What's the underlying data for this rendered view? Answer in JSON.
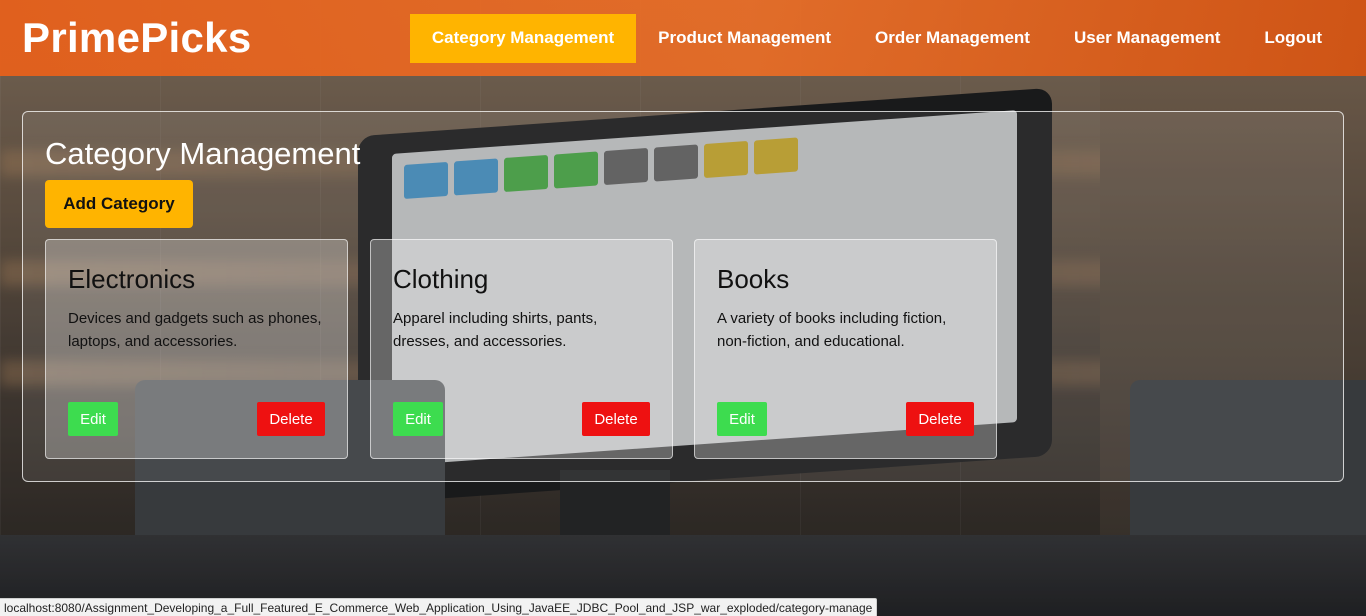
{
  "brand": "PrimePicks",
  "nav": {
    "items": [
      {
        "label": "Category Management",
        "active": true
      },
      {
        "label": "Product Management",
        "active": false
      },
      {
        "label": "Order Management",
        "active": false
      },
      {
        "label": "User Management",
        "active": false
      },
      {
        "label": "Logout",
        "active": false
      }
    ]
  },
  "panel": {
    "title": "Category Management",
    "add_label": "Add Category"
  },
  "categories": [
    {
      "name": "Electronics",
      "description": "Devices and gadgets such as phones, laptops, and accessories.",
      "edit_label": "Edit",
      "delete_label": "Delete"
    },
    {
      "name": "Clothing",
      "description": "Apparel including shirts, pants, dresses, and accessories.",
      "edit_label": "Edit",
      "delete_label": "Delete"
    },
    {
      "name": "Books",
      "description": "A variety of books including fiction, non-fiction, and educational.",
      "edit_label": "Edit",
      "delete_label": "Delete"
    }
  ],
  "status_bar": {
    "url": "localhost:8080/Assignment_Developing_a_Full_Featured_E_Commerce_Web_Application_Using_JavaEE_JDBC_Pool_and_JSP_war_exploded/category-manage"
  },
  "colors": {
    "navbar": "#ec6a22",
    "accent": "#ffb400",
    "edit": "#3ddc4f",
    "delete": "#ee1111"
  }
}
